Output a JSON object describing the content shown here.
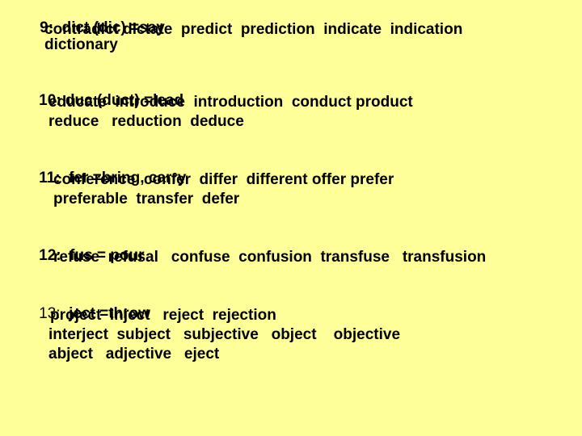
{
  "page": {
    "background_color": "#ffff99",
    "text_color": "#000000"
  },
  "sections": [
    {
      "number": "9:",
      "root": "dict (dic) =say",
      "lines": [
        "contradict dictate  predict  prediction  indicate  indication",
        "dictionary"
      ]
    },
    {
      "number": "10:",
      "root": "duc (duct) =lead",
      "lines": [
        "educate  introduce  introduction  conduct product",
        "reduce   reduction  deduce"
      ]
    },
    {
      "number": "11:",
      "root": "fer =bring, carry",
      "lines": [
        "conference  confer  differ  different offer prefer",
        "preferable  transfer  defer"
      ]
    },
    {
      "number": "12:",
      "root": "fus = pour",
      "lines": [
        "refuse  refusal   confuse  confusion  transfuse   transfusion"
      ]
    },
    {
      "number": "13:",
      "root": "ject =throw",
      "lines": [
        "project  inject   reject  rejection",
        "interject  subject   subjective   object    objective",
        "abject   adjective   eject"
      ]
    }
  ]
}
